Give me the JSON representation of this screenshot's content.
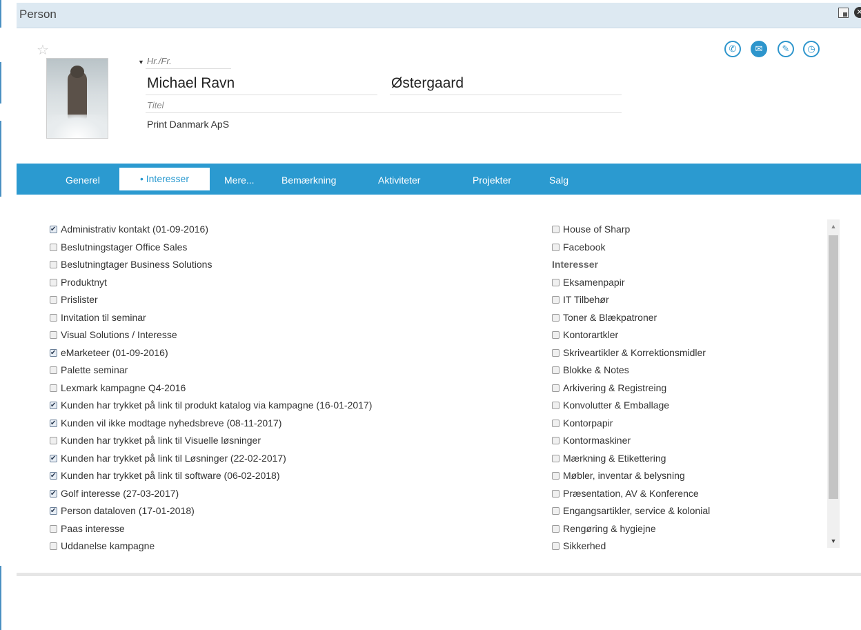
{
  "window": {
    "title": "Person"
  },
  "header": {
    "salutation": "Hr./Fr.",
    "first_name": "Michael Ravn",
    "last_name": "Østergaard",
    "title_placeholder": "Titel",
    "company": "Print Danmark ApS",
    "actions": [
      {
        "icon": "phone-icon",
        "glyph": "✆"
      },
      {
        "icon": "email-icon",
        "glyph": "✉"
      },
      {
        "icon": "edit-icon",
        "glyph": "✎"
      },
      {
        "icon": "clock-icon",
        "glyph": "◷"
      }
    ]
  },
  "tabs": [
    {
      "label": "Generel",
      "active": false
    },
    {
      "label": "• Interesser",
      "active": true
    },
    {
      "label": "Mere...",
      "active": false
    },
    {
      "label": "Bemærkning",
      "active": false
    },
    {
      "label": "Aktiviteter",
      "active": false
    },
    {
      "label": "Projekter",
      "active": false
    },
    {
      "label": "Salg",
      "active": false
    }
  ],
  "interests_left": [
    {
      "label": "Administrativ kontakt (01-09-2016)",
      "checked": true
    },
    {
      "label": "Beslutningstager Office Sales",
      "checked": false
    },
    {
      "label": "Beslutningtager Business Solutions",
      "checked": false
    },
    {
      "label": "Produktnyt",
      "checked": false
    },
    {
      "label": "Prislister",
      "checked": false
    },
    {
      "label": "Invitation til seminar",
      "checked": false
    },
    {
      "label": "Visual Solutions / Interesse",
      "checked": false
    },
    {
      "label": "eMarketeer (01-09-2016)",
      "checked": true
    },
    {
      "label": "Palette seminar",
      "checked": false
    },
    {
      "label": "Lexmark kampagne Q4-2016",
      "checked": false
    },
    {
      "label": "Kunden har trykket på link til produkt katalog via kampagne (16-01-2017)",
      "checked": true
    },
    {
      "label": "Kunden vil ikke modtage nyhedsbreve (08-11-2017)",
      "checked": true
    },
    {
      "label": "Kunden har trykket på link til Visuelle løsninger",
      "checked": false
    },
    {
      "label": "Kunden har trykket på link til Løsninger (22-02-2017)",
      "checked": true
    },
    {
      "label": "Kunden har trykket på link til software (06-02-2018)",
      "checked": true
    },
    {
      "label": "Golf interesse (27-03-2017)",
      "checked": true
    },
    {
      "label": "Person dataloven (17-01-2018)",
      "checked": true
    },
    {
      "label": "Paas interesse",
      "checked": false
    },
    {
      "label": "Uddanelse kampagne",
      "checked": false
    }
  ],
  "interests_right": [
    {
      "label": "House of Sharp",
      "checked": false
    },
    {
      "label": "Facebook",
      "checked": false
    },
    {
      "label": "Interesser",
      "section": true
    },
    {
      "label": "Eksamenpapir",
      "checked": false
    },
    {
      "label": "IT Tilbehør",
      "checked": false
    },
    {
      "label": "Toner & Blækpatroner",
      "checked": false
    },
    {
      "label": "Kontorartkler",
      "checked": false
    },
    {
      "label": "Skriveartikler & Korrektionsmidler",
      "checked": false
    },
    {
      "label": "Blokke & Notes",
      "checked": false
    },
    {
      "label": "Arkivering & Registreing",
      "checked": false
    },
    {
      "label": "Konvolutter & Emballage",
      "checked": false
    },
    {
      "label": "Kontorpapir",
      "checked": false
    },
    {
      "label": "Kontormaskiner",
      "checked": false
    },
    {
      "label": "Mærkning & Etikettering",
      "checked": false
    },
    {
      "label": "Møbler, inventar & belysning",
      "checked": false
    },
    {
      "label": "Præsentation, AV & Konference",
      "checked": false
    },
    {
      "label": "Engangsartikler, service & kolonial",
      "checked": false
    },
    {
      "label": "Rengøring & hygiejne",
      "checked": false
    },
    {
      "label": "Sikkerhed",
      "checked": false
    }
  ],
  "colors": {
    "accent": "#2b9ad0",
    "titlebar": "#dde9f2"
  }
}
